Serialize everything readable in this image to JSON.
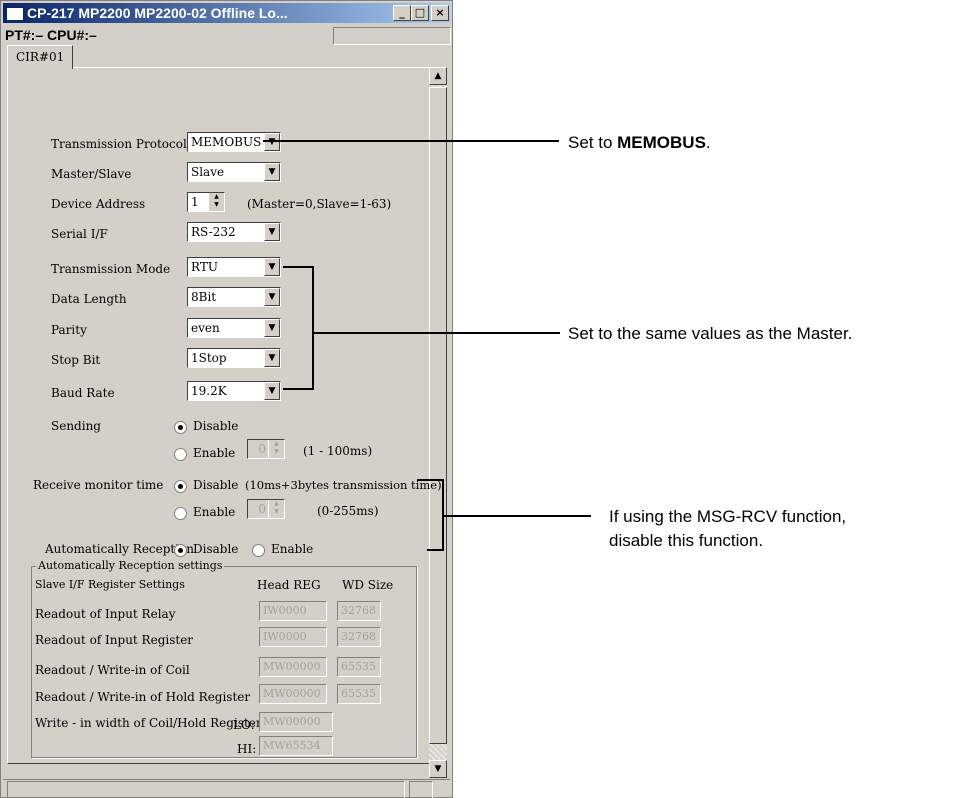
{
  "window": {
    "title": "CP-217   MP2200    MP2200-02 Offline  Lo..."
  },
  "status": {
    "pt_cpu": "PT#:– CPU#:–"
  },
  "tab": {
    "label": "CIR#01"
  },
  "fields": {
    "protocol": {
      "label": "Transmission Protocol",
      "value": "MEMOBUS"
    },
    "master_slave": {
      "label": "Master/Slave",
      "value": "Slave"
    },
    "device_address": {
      "label": "Device Address",
      "value": "1",
      "hint": "(Master=0,Slave=1-63)"
    },
    "serial_if": {
      "label": "Serial I/F",
      "value": "RS-232"
    },
    "mode": {
      "label": "Transmission Mode",
      "value": "RTU"
    },
    "data_length": {
      "label": "Data Length",
      "value": "8Bit"
    },
    "parity": {
      "label": "Parity",
      "value": "even"
    },
    "stop_bit": {
      "label": "Stop Bit",
      "value": "1Stop"
    },
    "baud": {
      "label": "Baud Rate",
      "value": "19.2K"
    }
  },
  "sending": {
    "label": "Sending",
    "disable": "Disable",
    "enable": "Enable",
    "value": "0",
    "range": "(1 - 100ms)"
  },
  "receive": {
    "label": "Receive monitor time",
    "disable": "Disable",
    "disable_hint": "(10ms+3bytes transmission time)",
    "enable": "Enable",
    "value": "0",
    "range": "(0-255ms)"
  },
  "auto_reception": {
    "label": "Automatically Reception",
    "disable": "Disable",
    "enable": "Enable"
  },
  "settings_group": {
    "title": "Automatically Reception settings",
    "col_slave": "Slave I/F Register Settings",
    "col_head": "Head REG",
    "col_size": "WD Size",
    "rows": [
      {
        "label": "Readout of Input Relay",
        "head": "IW0000",
        "size": "32768"
      },
      {
        "label": "Readout of Input Register",
        "head": "IW0000",
        "size": "32768"
      },
      {
        "label": "Readout / Write-in of Coil",
        "head": "MW00000",
        "size": "65535"
      },
      {
        "label": "Readout / Write-in of Hold Register",
        "head": "MW00000",
        "size": "65535"
      }
    ],
    "width": {
      "label": "Write - in width of Coil/Hold Register",
      "lo_label": "LO:",
      "lo": "MW00000",
      "hi_label": "HI:",
      "hi": "MW65534"
    }
  },
  "annotations": {
    "a1_prefix": "Set to ",
    "a1_bold": "MEMOBUS",
    "a1_suffix": ".",
    "a2": "Set to the same values as the Master.",
    "a3_line1": "If using the MSG-RCV function,",
    "a3_line2": "disable this function."
  }
}
